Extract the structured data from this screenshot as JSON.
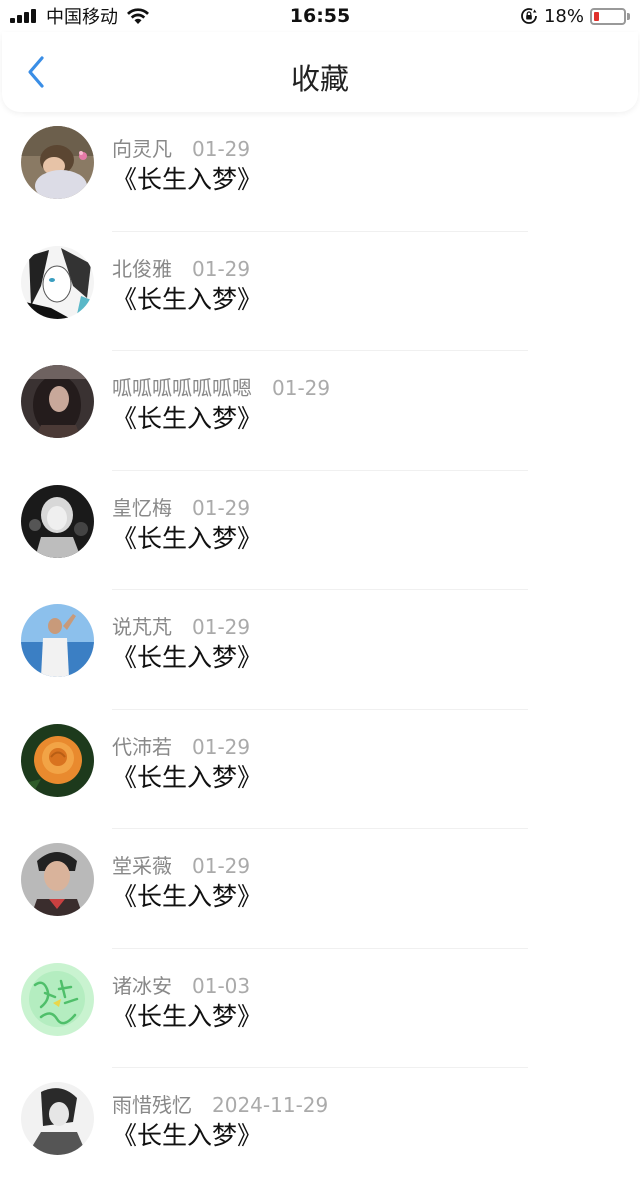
{
  "status_bar": {
    "carrier": "中国移动",
    "time": "16:55",
    "battery_percent": "18%",
    "battery_level": 0.18,
    "battery_color": "#e0302b",
    "icons": [
      "signal-icon",
      "wifi-icon",
      "rotation-lock-icon",
      "battery-icon"
    ]
  },
  "header": {
    "title": "收藏",
    "back_icon": "chevron-left-icon",
    "accent_color": "#3a8ee6"
  },
  "favorites": [
    {
      "author": "向灵凡",
      "date": "01-29",
      "title": "《长生入梦》",
      "avatar": "child-hug-photo"
    },
    {
      "author": "北俊雅",
      "date": "01-29",
      "title": "《长生入梦》",
      "avatar": "manga-girl-bw"
    },
    {
      "author": "呱呱呱呱呱呱嗯",
      "date": "01-29",
      "title": "《长生入梦》",
      "avatar": "dark-hair-woman"
    },
    {
      "author": "皇忆梅",
      "date": "01-29",
      "title": "《长生入梦》",
      "avatar": "girl-bw-photo"
    },
    {
      "author": "说芃芃",
      "date": "01-29",
      "title": "《长生入梦》",
      "avatar": "man-by-sea"
    },
    {
      "author": "代沛若",
      "date": "01-29",
      "title": "《长生入梦》",
      "avatar": "orange-rose"
    },
    {
      "author": "堂采薇",
      "date": "01-29",
      "title": "《长生入梦》",
      "avatar": "young-man-portrait"
    },
    {
      "author": "诸冰安",
      "date": "01-03",
      "title": "《长生入梦》",
      "avatar": "green-calligraphy"
    },
    {
      "author": "雨惜残忆",
      "date": "2024-11-29",
      "title": "《长生入梦》",
      "avatar": "bw-sketch"
    }
  ]
}
